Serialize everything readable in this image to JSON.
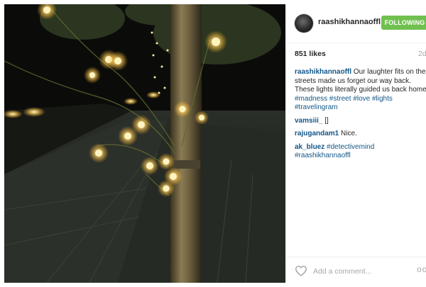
{
  "post": {
    "username": "raashikhannaoffl",
    "follow_label": "FOLLOWING",
    "likes": "851 likes",
    "time": "2d",
    "caption": {
      "user": "raashikhannaoffl",
      "text": "Our laughter fits on the streets made us forget our way back. These lights literally guided us back home!",
      "tags": [
        "#madness",
        "#street",
        "#love",
        "#lights",
        "#travelingram"
      ]
    },
    "comments": [
      {
        "user": "vamsiii_",
        "text": "[]"
      },
      {
        "user": "rajugandam1",
        "text": "Nice."
      },
      {
        "user": "ak_bluez",
        "tags": [
          "#detectivemind",
          "#raashikhannaoffl"
        ]
      }
    ],
    "add_comment_placeholder": "Add a comment...",
    "more_label": "oo"
  },
  "colors": {
    "follow_button": "#70c050",
    "link": "#125688",
    "text": "#262626",
    "muted": "#a5a7aa"
  },
  "icons": [
    "heart-icon",
    "more-options-icon"
  ]
}
